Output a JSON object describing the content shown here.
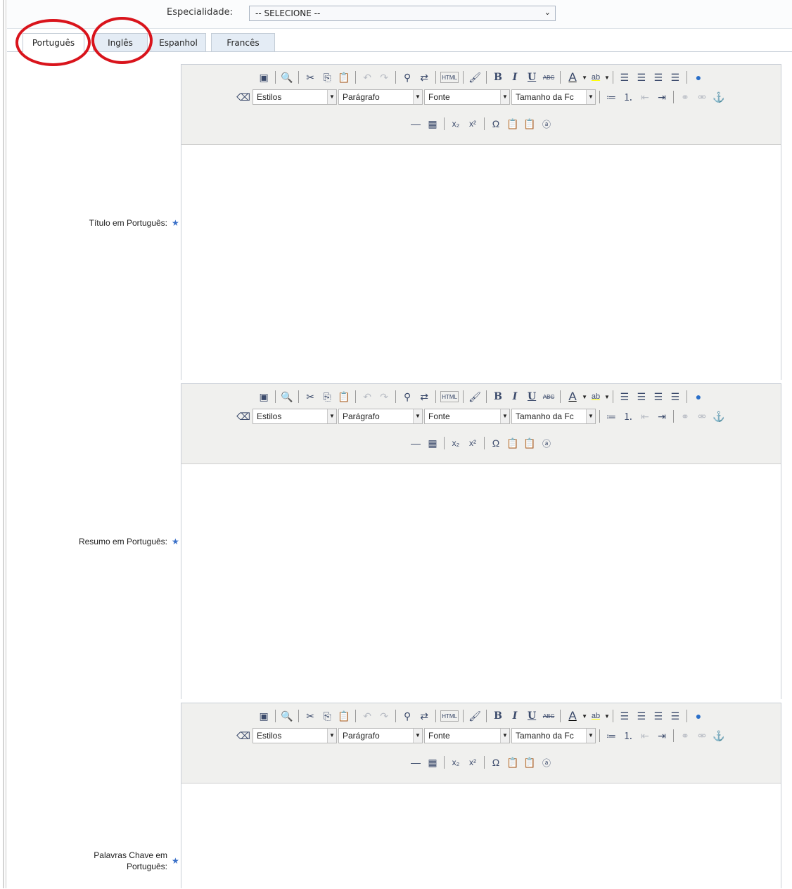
{
  "specialty": {
    "label": "Especialidade:",
    "value": "-- SELECIONE --",
    "arrow": "⌄"
  },
  "tabs": [
    {
      "label": "Português",
      "active": true
    },
    {
      "label": "Inglês",
      "active": false
    },
    {
      "label": "Espanhol",
      "active": false
    },
    {
      "label": "Francês",
      "active": false
    }
  ],
  "annotation_color": "#d9141c",
  "toolbar": {
    "styles": "Estilos",
    "paragraph": "Parágrafo",
    "font": "Fonte",
    "size": "Tamanho da Fc",
    "bold": "B",
    "italic": "I",
    "underline": "U",
    "strike": "ABC",
    "html": "HTML"
  },
  "fields": {
    "titulo": {
      "label": "Título em Português:"
    },
    "resumo": {
      "label": "Resumo em Português:"
    },
    "palavras": {
      "label1": "Palavras Chave em",
      "label2": "Português:"
    }
  },
  "required_mark": "★"
}
